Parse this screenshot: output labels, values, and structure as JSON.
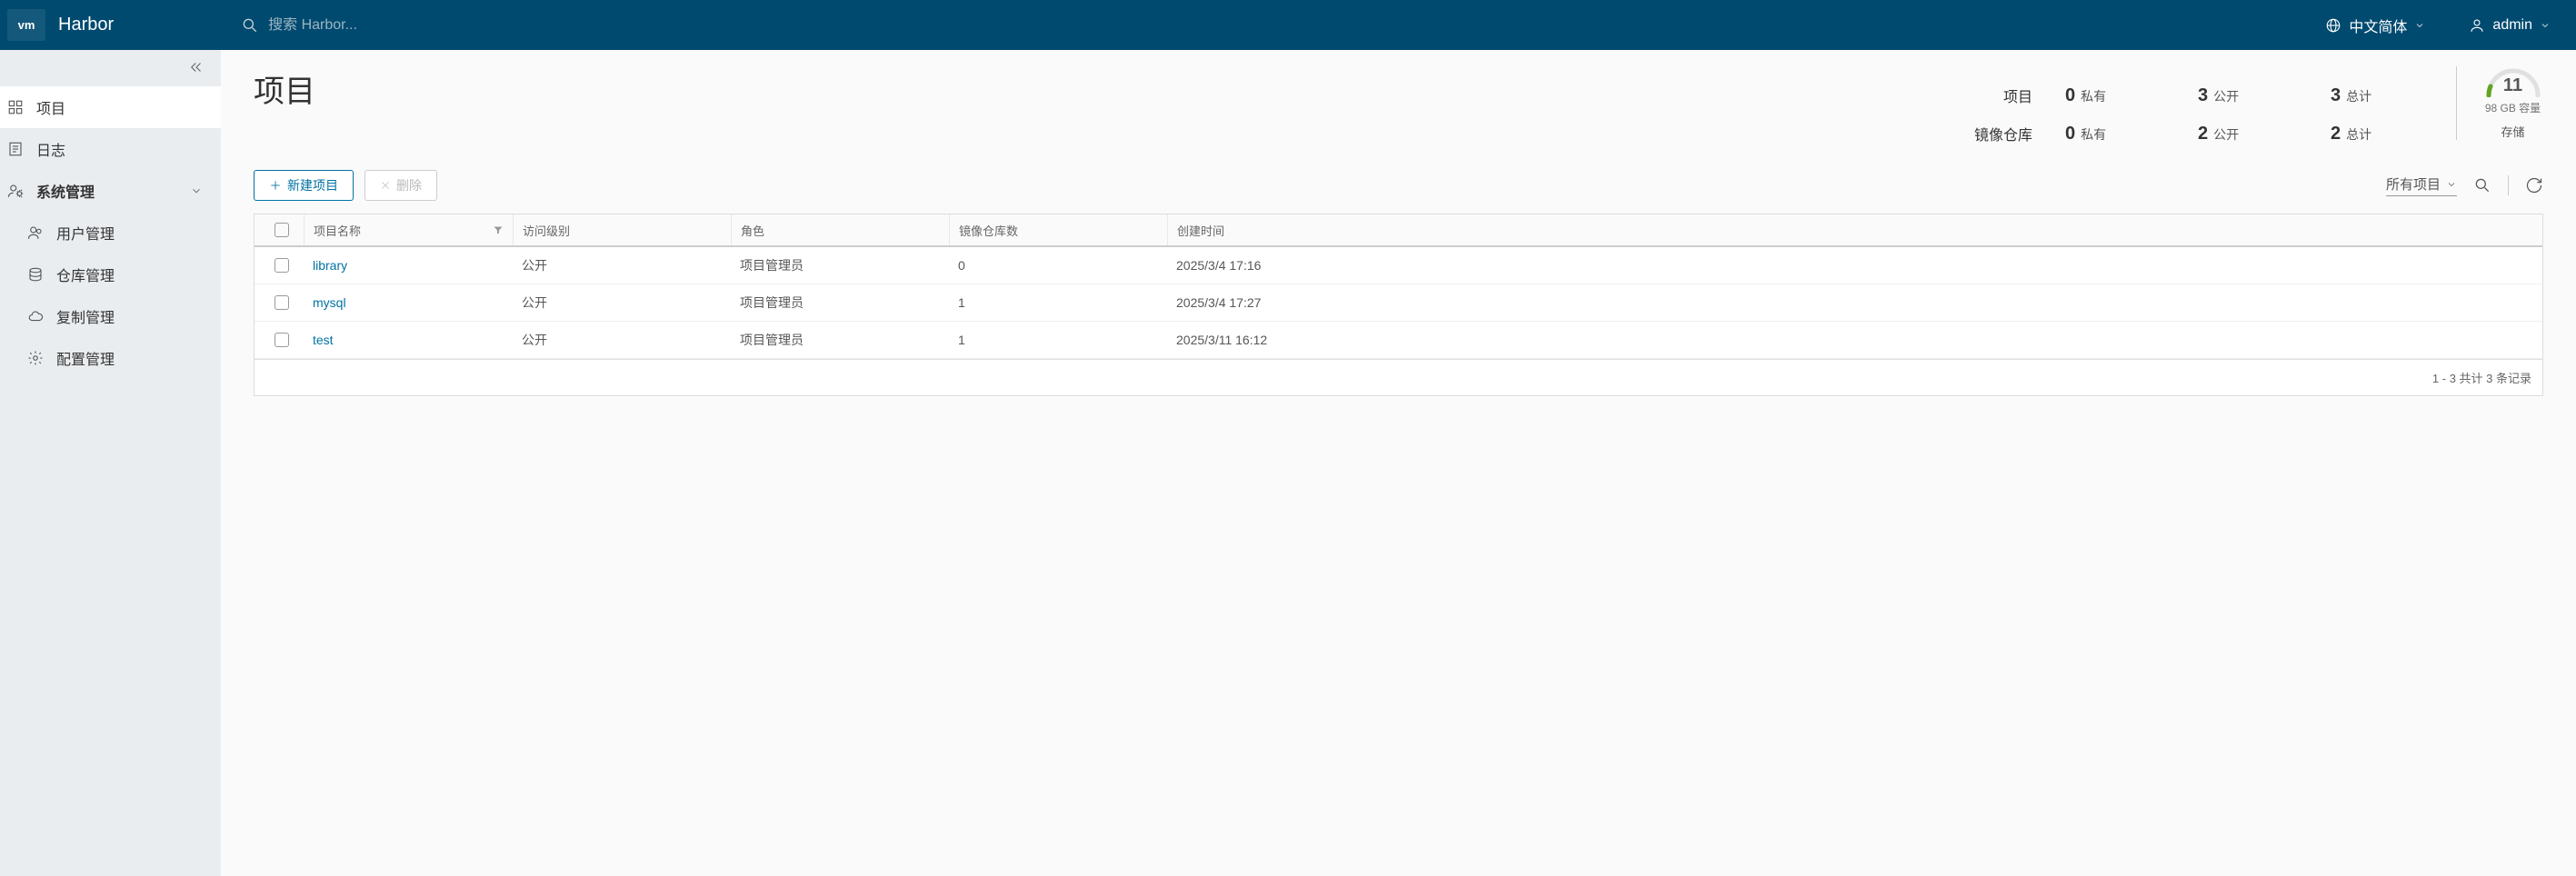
{
  "header": {
    "logo_text": "vm",
    "app_name": "Harbor",
    "search_placeholder": "搜索 Harbor...",
    "language_label": "中文简体",
    "user_label": "admin"
  },
  "sidebar": {
    "projects": "项目",
    "logs": "日志",
    "system_mgmt": "系统管理",
    "user_mgmt": "用户管理",
    "repo_mgmt": "仓库管理",
    "replication_mgmt": "复制管理",
    "config_mgmt": "配置管理"
  },
  "main": {
    "title": "项目",
    "stats": {
      "projects_label": "项目",
      "repos_label": "镜像仓库",
      "private_label": "私有",
      "public_label": "公开",
      "total_label": "总计",
      "projects_private": "0",
      "projects_public": "3",
      "projects_total": "3",
      "repos_private": "0",
      "repos_public": "2",
      "repos_total": "2"
    },
    "storage": {
      "value": "11",
      "detail": "98 GB 容量",
      "label": "存储"
    }
  },
  "toolbar": {
    "new_project": "新建项目",
    "delete": "删除",
    "filter_label": "所有项目"
  },
  "table": {
    "columns": {
      "name": "项目名称",
      "access": "访问级别",
      "role": "角色",
      "repo_count": "镜像仓库数",
      "created": "创建时间"
    },
    "rows": [
      {
        "name": "library",
        "access": "公开",
        "role": "项目管理员",
        "repo_count": "0",
        "created": "2025/3/4 17:16"
      },
      {
        "name": "mysql",
        "access": "公开",
        "role": "项目管理员",
        "repo_count": "1",
        "created": "2025/3/4 17:27"
      },
      {
        "name": "test",
        "access": "公开",
        "role": "项目管理员",
        "repo_count": "1",
        "created": "2025/3/11 16:12"
      }
    ],
    "footer": "1 - 3 共计 3 条记录"
  }
}
